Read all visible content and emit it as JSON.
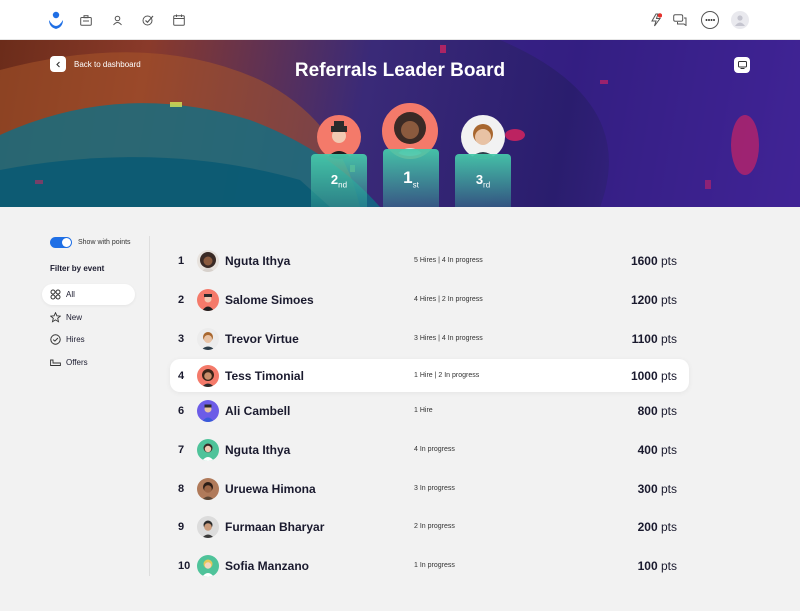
{
  "nav": {
    "icons": [
      "logo-icon",
      "briefcase-icon",
      "person-icon",
      "tasks-icon",
      "calendar-icon"
    ],
    "right_icons": [
      "bolt-icon",
      "chat-icon",
      "apps-icon",
      "user-avatar-icon"
    ]
  },
  "hero": {
    "back_label": "Back to dashboard",
    "title": "Referrals Leader Board",
    "podium": [
      {
        "place": "2",
        "suffix": "nd"
      },
      {
        "place": "1",
        "suffix": "st"
      },
      {
        "place": "3",
        "suffix": "rd"
      }
    ]
  },
  "sidebar": {
    "toggle_label": "Show with points",
    "toggle_on": true,
    "filter_title": "Filter by event",
    "filters": [
      {
        "label": "All",
        "icon": "grid-icon"
      },
      {
        "label": "New",
        "icon": "star-icon"
      },
      {
        "label": "Hires",
        "icon": "check-circle-icon"
      },
      {
        "label": "Offers",
        "icon": "sofa-icon"
      }
    ]
  },
  "leaderboard": [
    {
      "rank": "1",
      "name": "Nguta Ithya",
      "stats": "5 Hires  |  4 In progress",
      "points": "1600",
      "unit": "pts"
    },
    {
      "rank": "2",
      "name": "Salome Simoes",
      "stats": "4 Hires  |  2 In progress",
      "points": "1200",
      "unit": "pts"
    },
    {
      "rank": "3",
      "name": "Trevor Virtue",
      "stats": "3 Hires  |  4 In progress",
      "points": "1100",
      "unit": "pts"
    },
    {
      "rank": "4",
      "name": "Tess Timonial",
      "stats": "1 Hire   |  2 In progress",
      "points": "1000",
      "unit": "pts"
    },
    {
      "rank": "6",
      "name": "Ali Cambell",
      "stats": "1 Hire",
      "points": "800",
      "unit": "pts"
    },
    {
      "rank": "7",
      "name": "Nguta Ithya",
      "stats": "4 In progress",
      "points": "400",
      "unit": "pts"
    },
    {
      "rank": "8",
      "name": "Uruewa Himona",
      "stats": "3 In progress",
      "points": "300",
      "unit": "pts"
    },
    {
      "rank": "9",
      "name": "Furmaan Bharyar",
      "stats": "2 In progress",
      "points": "200",
      "unit": "pts"
    },
    {
      "rank": "10",
      "name": "Sofia Manzano",
      "stats": "1 In progress",
      "points": "100",
      "unit": "pts"
    }
  ],
  "colors": {
    "accent": "#1f6fe5",
    "podium": "#46c8aa",
    "avatar_coral": "#f47a6a",
    "avatar_green": "#4fc39a",
    "avatar_purple": "#6c5ce7"
  }
}
